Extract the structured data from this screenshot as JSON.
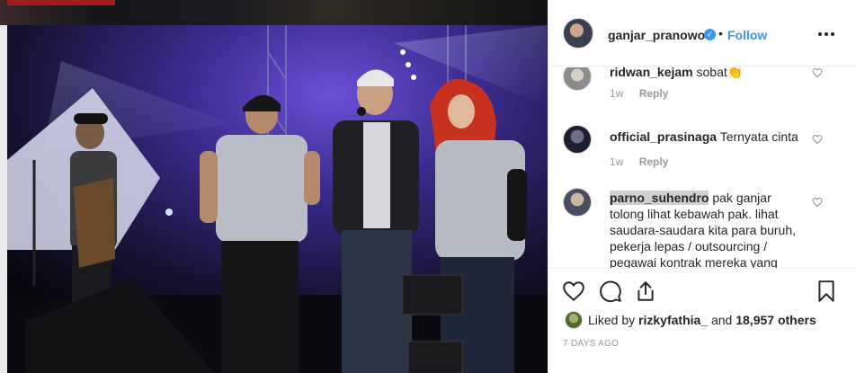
{
  "post": {
    "username": "ganjar_pranowo",
    "verified_mark": "✓",
    "separator": "•",
    "follow_label": "Follow",
    "options_icon": "more-horizontal-icon"
  },
  "comments": [
    {
      "username": "ridwan_kejam",
      "text": "sobat👏",
      "time": "1w",
      "reply_label": "Reply"
    },
    {
      "username": "official_prasinaga",
      "text": "Ternyata cinta",
      "time": "1w",
      "reply_label": "Reply"
    },
    {
      "username": "parno_suhendro",
      "text": "pak ganjar tolong lihat kebawah pak. lihat saudara-saudara kita para buruh, pekerja lepas / outsourcing / pegawai kontrak mereka yang"
    }
  ],
  "likes": {
    "prefix": "Liked by",
    "user": "rizkyfathia_",
    "middle": "and",
    "count": "18,957 others"
  },
  "date": "7 DAYS AGO",
  "colors": {
    "accent": "#3897f0",
    "text": "#262626",
    "muted": "#999999"
  }
}
